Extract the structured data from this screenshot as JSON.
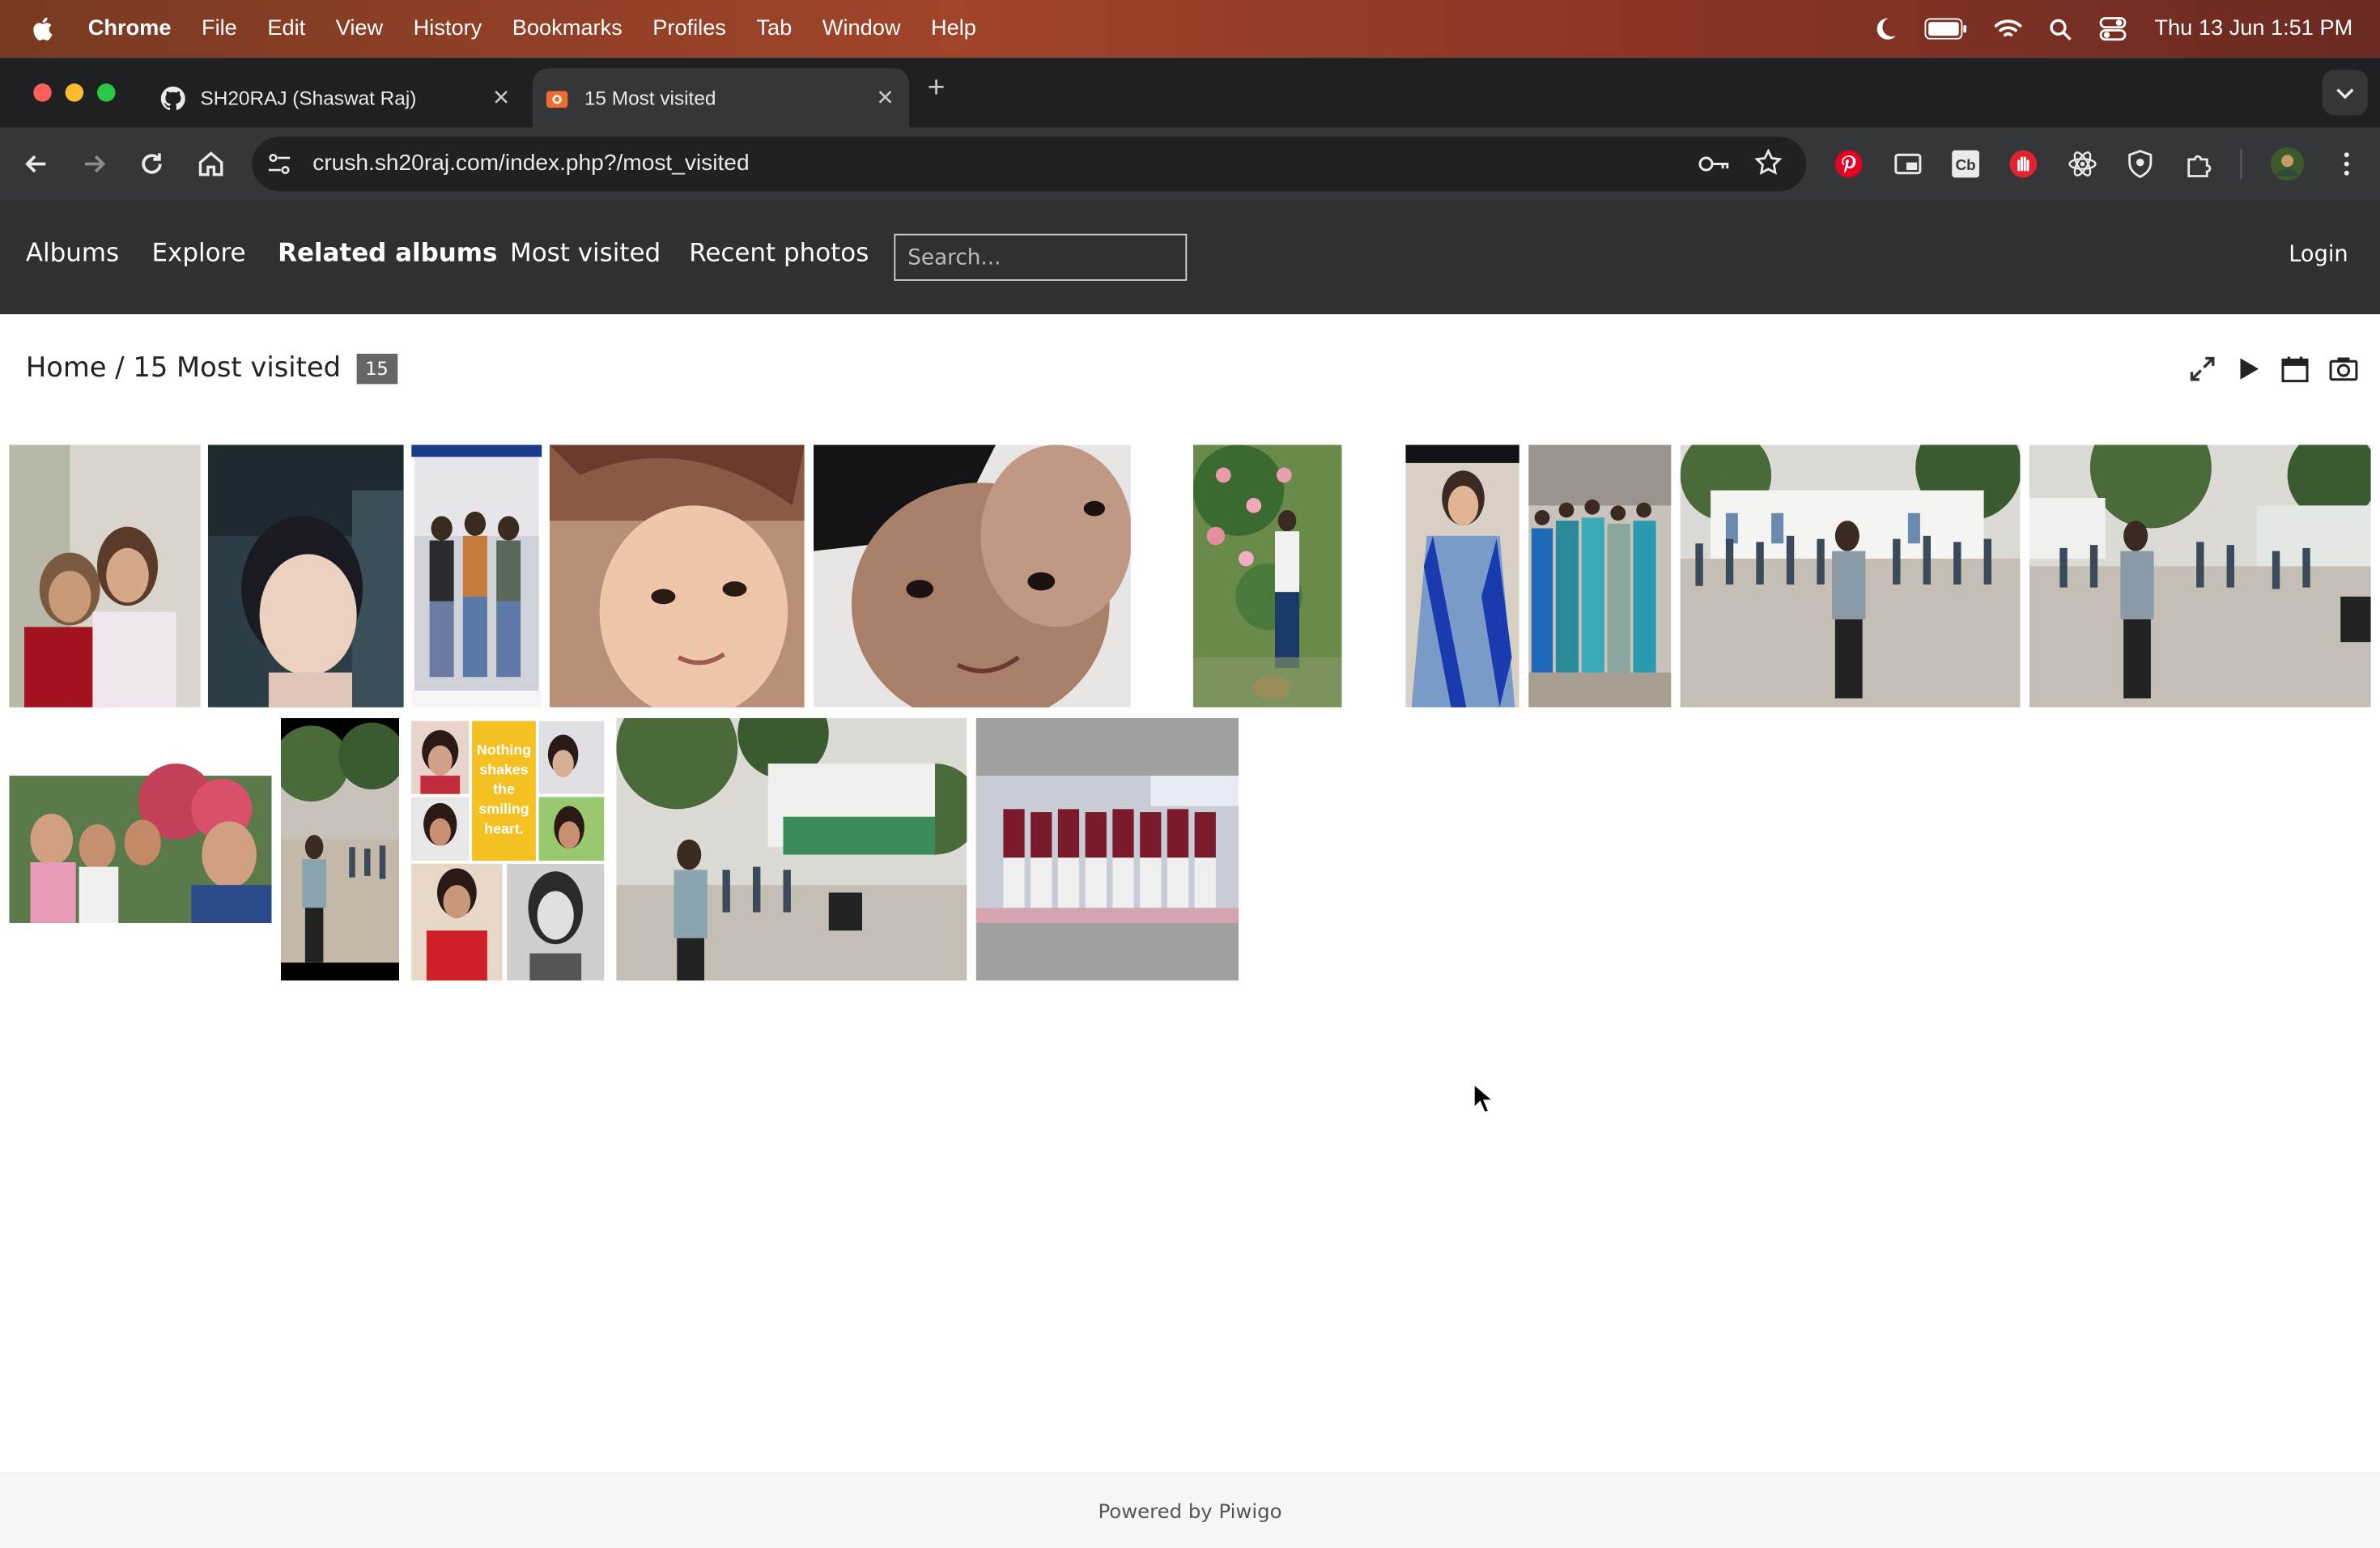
{
  "menubar": {
    "app": "Chrome",
    "items": [
      "File",
      "Edit",
      "View",
      "History",
      "Bookmarks",
      "Profiles",
      "Tab",
      "Window",
      "Help"
    ],
    "clock": "Thu 13 Jun  1:51 PM"
  },
  "tabs": [
    {
      "title": "SH20RAJ (Shaswat Raj)",
      "icon": "github-icon"
    },
    {
      "title": "15 Most visited",
      "icon": "piwigo-icon"
    }
  ],
  "address": {
    "url": "crush.sh20raj.com/index.php?/most_visited"
  },
  "nav": {
    "albums": "Albums",
    "explore": "Explore",
    "related": "Related albums",
    "most_visited": "Most visited",
    "recent": "Recent photos",
    "search_placeholder": "Search...",
    "login": "Login"
  },
  "title": {
    "home": "Home",
    "separator": " / ",
    "page": "15 Most visited",
    "count": "15"
  },
  "thumbnails": [
    {
      "scene": "two-girls-selfie"
    },
    {
      "scene": "girl-short-hair-door"
    },
    {
      "scene": "group-three-girls-screenshot"
    },
    {
      "scene": "girl-close-up-face"
    },
    {
      "scene": "girl-smiling-close-up"
    },
    {
      "scene": "girl-pink-flowers"
    },
    {
      "scene": "girl-blue-dress"
    },
    {
      "scene": "group-girls-sarees"
    },
    {
      "scene": "school-yard-crowd"
    },
    {
      "scene": "school-yard-crowd-2"
    },
    {
      "scene": "girls-selfie-flowers"
    },
    {
      "scene": "boy-school-yard-portrait"
    },
    {
      "scene": "collage-nothing-shakes"
    },
    {
      "scene": "school-building-yard"
    },
    {
      "scene": "group-students-uniform"
    }
  ],
  "collage_text": "Nothing shakes the smiling heart.",
  "footer": {
    "prefix": "Powered by ",
    "link": "Piwigo"
  }
}
